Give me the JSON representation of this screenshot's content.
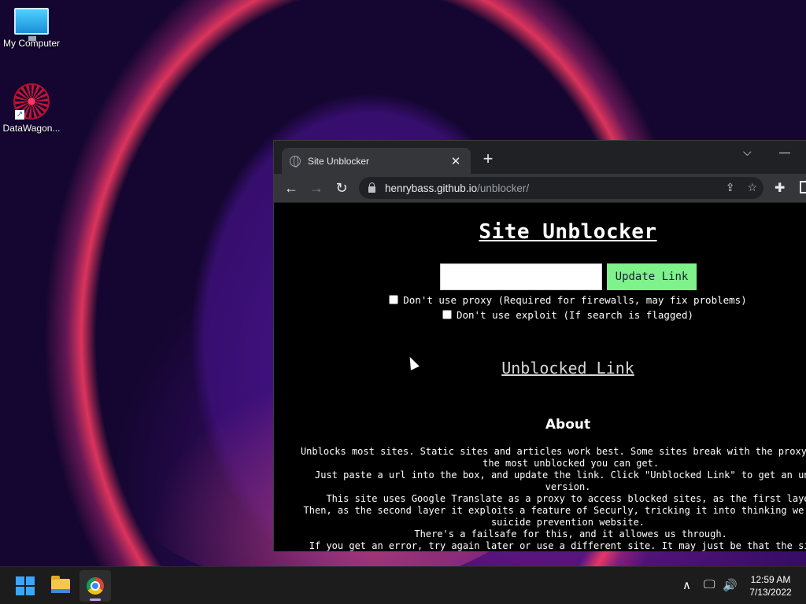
{
  "desktop": {
    "icons": [
      {
        "label": "My Computer",
        "icon": "monitor-icon"
      },
      {
        "label": "DataWagon...",
        "icon": "datawagon-mandala-icon"
      }
    ]
  },
  "browser": {
    "tab": {
      "title": "Site Unblocker",
      "icon": "globe-icon"
    },
    "address": {
      "host": "henrybass.github.io",
      "path": "/unblocker/"
    },
    "colors": {
      "tabbar": "#202124",
      "toolbar": "#35363a"
    }
  },
  "page": {
    "title": "Site Unblocker",
    "input_value": "",
    "update_button": "Update Link",
    "checkbox_proxy": "Don't use proxy (Required for firewalls, may fix problems)",
    "checkbox_exploit": "Don't use exploit (If search is flagged)",
    "unblocked_link": "Unblocked Link",
    "about_heading": "About",
    "about_text": "Unblocks most sites. Static sites and articles work best. Some sites break with the proxy, but\n the most unblocked you can get.\n Just paste a url into the box, and update the link. Click \"Unblocked Link\" to get an unble\nversion.\n This site uses Google Translate as a proxy to access blocked sites, as the first layer\nThen, as the second layer it exploits a feature of Securly, tricking it into thinking we're v\nsuicide prevention website.\n There's a failsafe for this, and it allowes us through.\n If you get an error, try again later or use a different site. It may just be that the site b",
    "colors": {
      "background": "#000000",
      "button": "#7ff28b"
    }
  },
  "taskbar": {
    "time": "12:59 AM",
    "date": "7/13/2022",
    "pinned": [
      "start-icon",
      "file-explorer-icon",
      "chrome-icon"
    ]
  }
}
